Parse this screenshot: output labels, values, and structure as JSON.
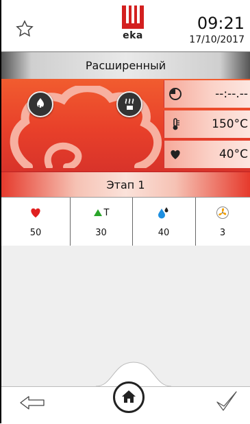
{
  "header": {
    "logo_text": "eka",
    "time": "09:21",
    "date": "17/10/2017"
  },
  "mode": {
    "label": "Расширенный"
  },
  "settings": {
    "timer": "--:--.--",
    "temperature": "150°C",
    "core_temp": "40°C"
  },
  "stage": {
    "label": "Этап 1"
  },
  "params": [
    {
      "icon": "heart-icon",
      "value": "50"
    },
    {
      "icon": "delta-t-icon",
      "label": "T",
      "value": "30"
    },
    {
      "icon": "humidity-icon",
      "value": "40"
    },
    {
      "icon": "fan-icon",
      "value": "3"
    }
  ],
  "colors": {
    "accent": "#e8402a",
    "heart": "#e02020",
    "delta": "#2aa52a",
    "water": "#1d8fe0",
    "fan": "#f3a000"
  }
}
